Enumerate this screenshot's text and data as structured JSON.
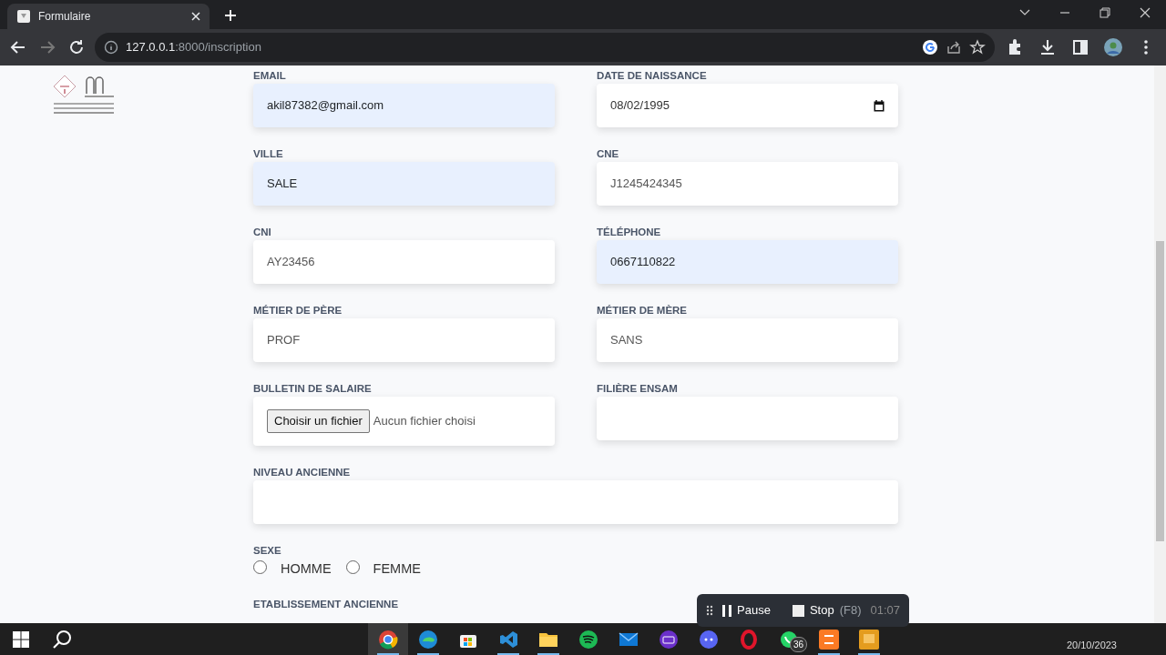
{
  "browser": {
    "tab": {
      "title": "Formulaire"
    },
    "url": {
      "host": "127.0.0.1",
      "path": ":8000/inscription"
    }
  },
  "form": {
    "rows": [
      [
        {
          "label": "EMAIL",
          "kind": "text",
          "value": "akil87382@gmail.com",
          "autofilled": true
        },
        {
          "label": "DATE DE NAISSANCE",
          "kind": "date",
          "value": "08/02/1995",
          "autofilled": false
        }
      ],
      [
        {
          "label": "VILLE",
          "kind": "text",
          "value": "SALE",
          "autofilled": true
        },
        {
          "label": "CNE",
          "kind": "text",
          "value": "J1245424345",
          "autofilled": false
        }
      ],
      [
        {
          "label": "CNI",
          "kind": "text",
          "value": "AY23456",
          "autofilled": false
        },
        {
          "label": "TÉLÉPHONE",
          "kind": "text",
          "value": "0667110822",
          "autofilled": true
        }
      ],
      [
        {
          "label": "MÉTIER DE PÈRE",
          "kind": "text",
          "value": "PROF",
          "autofilled": false
        },
        {
          "label": "MÉTIER DE MÈRE",
          "kind": "text",
          "value": "SANS",
          "autofilled": false
        }
      ],
      [
        {
          "label": "BULLETIN DE SALAIRE",
          "kind": "file",
          "button": "Choisir un fichier",
          "status": "Aucun fichier choisi"
        },
        {
          "label": "FILIÈRE ENSAM",
          "kind": "select"
        }
      ],
      [
        {
          "label": "NIVEAU ANCIENNE",
          "kind": "select"
        }
      ]
    ],
    "sexe": {
      "label": "SEXE",
      "options": [
        {
          "label": "HOMME",
          "selected": false
        },
        {
          "label": "FEMME",
          "selected": false
        }
      ]
    },
    "next_label": "ETABLISSEMENT ANCIENNE"
  },
  "recorder": {
    "buttons": [
      {
        "kind": "pause",
        "label": "Pause"
      },
      {
        "kind": "stop",
        "label": "Stop",
        "shortcut": "(F8)"
      }
    ],
    "timer": "01:07"
  },
  "taskbar": {
    "apps": [
      {
        "kind": "chrome",
        "open": true,
        "selected": true
      },
      {
        "kind": "edge",
        "open": true,
        "selected": false
      },
      {
        "kind": "store",
        "open": false,
        "selected": false
      },
      {
        "kind": "vscode",
        "open": true,
        "selected": false
      },
      {
        "kind": "folder",
        "open": true,
        "selected": false
      },
      {
        "kind": "spotify",
        "open": false,
        "selected": false
      },
      {
        "kind": "mail",
        "open": false,
        "selected": false
      },
      {
        "kind": "tv",
        "open": false,
        "selected": false
      },
      {
        "kind": "discord",
        "open": false,
        "selected": false
      },
      {
        "kind": "opera",
        "open": false,
        "selected": false
      },
      {
        "kind": "whatsapp",
        "open": false,
        "selected": false,
        "badge": "36"
      },
      {
        "kind": "xampp",
        "open": true,
        "selected": false
      },
      {
        "kind": "app",
        "open": true,
        "selected": false
      }
    ],
    "date": "20/10/2023"
  }
}
